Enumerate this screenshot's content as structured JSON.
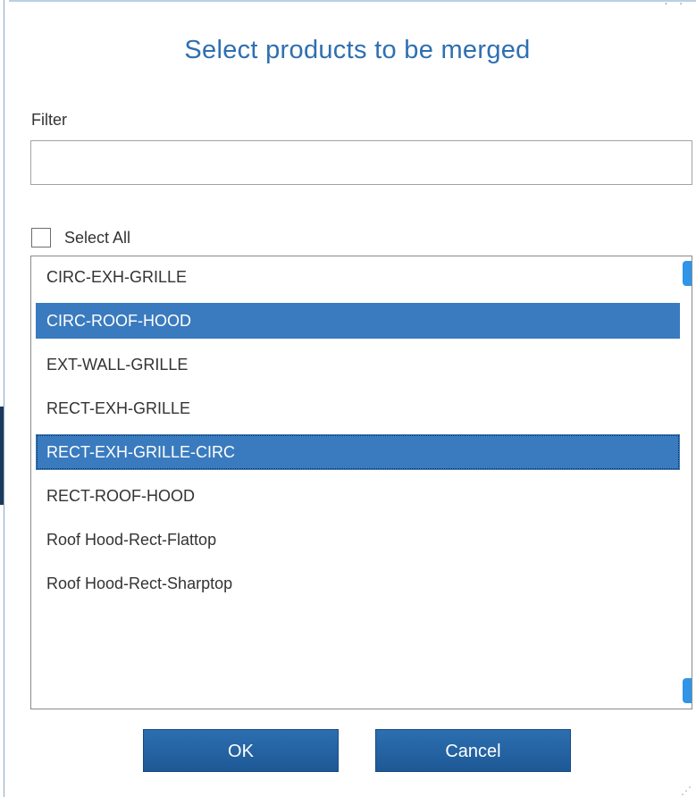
{
  "dialog": {
    "title": "Select products to be merged"
  },
  "filter": {
    "label": "Filter",
    "value": "",
    "placeholder": ""
  },
  "select_all": {
    "label": "Select All",
    "checked": false
  },
  "products": [
    {
      "label": "CIRC-EXH-GRILLE",
      "selected": false
    },
    {
      "label": "CIRC-ROOF-HOOD",
      "selected": true
    },
    {
      "label": "EXT-WALL-GRILLE",
      "selected": false
    },
    {
      "label": "RECT-EXH-GRILLE",
      "selected": false
    },
    {
      "label": "RECT-EXH-GRILLE-CIRC",
      "selected": true,
      "focused": true
    },
    {
      "label": "RECT-ROOF-HOOD",
      "selected": false
    },
    {
      "label": "Roof Hood-Rect-Flattop",
      "selected": false
    },
    {
      "label": "Roof Hood-Rect-Sharptop",
      "selected": false
    }
  ],
  "buttons": {
    "ok_label": "OK",
    "cancel_label": "Cancel"
  },
  "colors": {
    "title": "#2e6fb1",
    "selection": "#3a7bbf",
    "button": "#1e5896",
    "scrollbar": "#2f95e8"
  },
  "icons": {
    "resize_grip": "resize-grip-icon"
  }
}
